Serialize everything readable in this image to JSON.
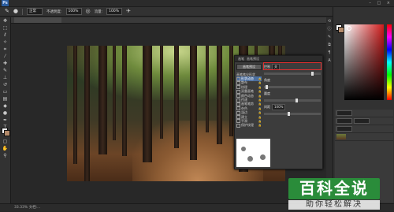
{
  "app": {
    "logo": "Ps",
    "window_controls": "– □ ×"
  },
  "options_bar": {
    "mode_label": "正常",
    "opacity_label": "不透明度:",
    "opacity_value": "100%",
    "flow_label": "流量:",
    "flow_value": "100%"
  },
  "brush_panel": {
    "tabs": [
      "画笔",
      "画笔预设"
    ],
    "preset_button": "画笔预设",
    "tip_shape_label": "画笔笔尖形状",
    "options": [
      {
        "label": "形状动态",
        "selected": true
      },
      {
        "label": "散布",
        "selected": false
      },
      {
        "label": "纹理",
        "selected": false
      },
      {
        "label": "双重画笔",
        "selected": false
      },
      {
        "label": "颜色动态",
        "selected": false
      },
      {
        "label": "传递",
        "selected": false
      },
      {
        "label": "画笔笔势",
        "selected": false
      },
      {
        "label": "杂色",
        "selected": false
      },
      {
        "label": "湿边",
        "selected": false
      },
      {
        "label": "建立",
        "selected": false
      },
      {
        "label": "平滑",
        "selected": false
      },
      {
        "label": "保护纹理",
        "selected": false
      }
    ],
    "size_label": "大小",
    "size_value": "",
    "jitter_label": "控制",
    "jitter_value": "关",
    "angle_label": "角度",
    "roundness_label": "圆度",
    "spacing_label": "间距",
    "spacing_value": "100%",
    "highlight": "红框"
  },
  "status_bar": {
    "zoom": "33.33%",
    "doc": "文档:..."
  },
  "watermark": {
    "title": "百科全说",
    "subtitle": "助你轻松解决"
  },
  "colors": {
    "foreground": "#ffffff",
    "background": "#b38a6a"
  }
}
